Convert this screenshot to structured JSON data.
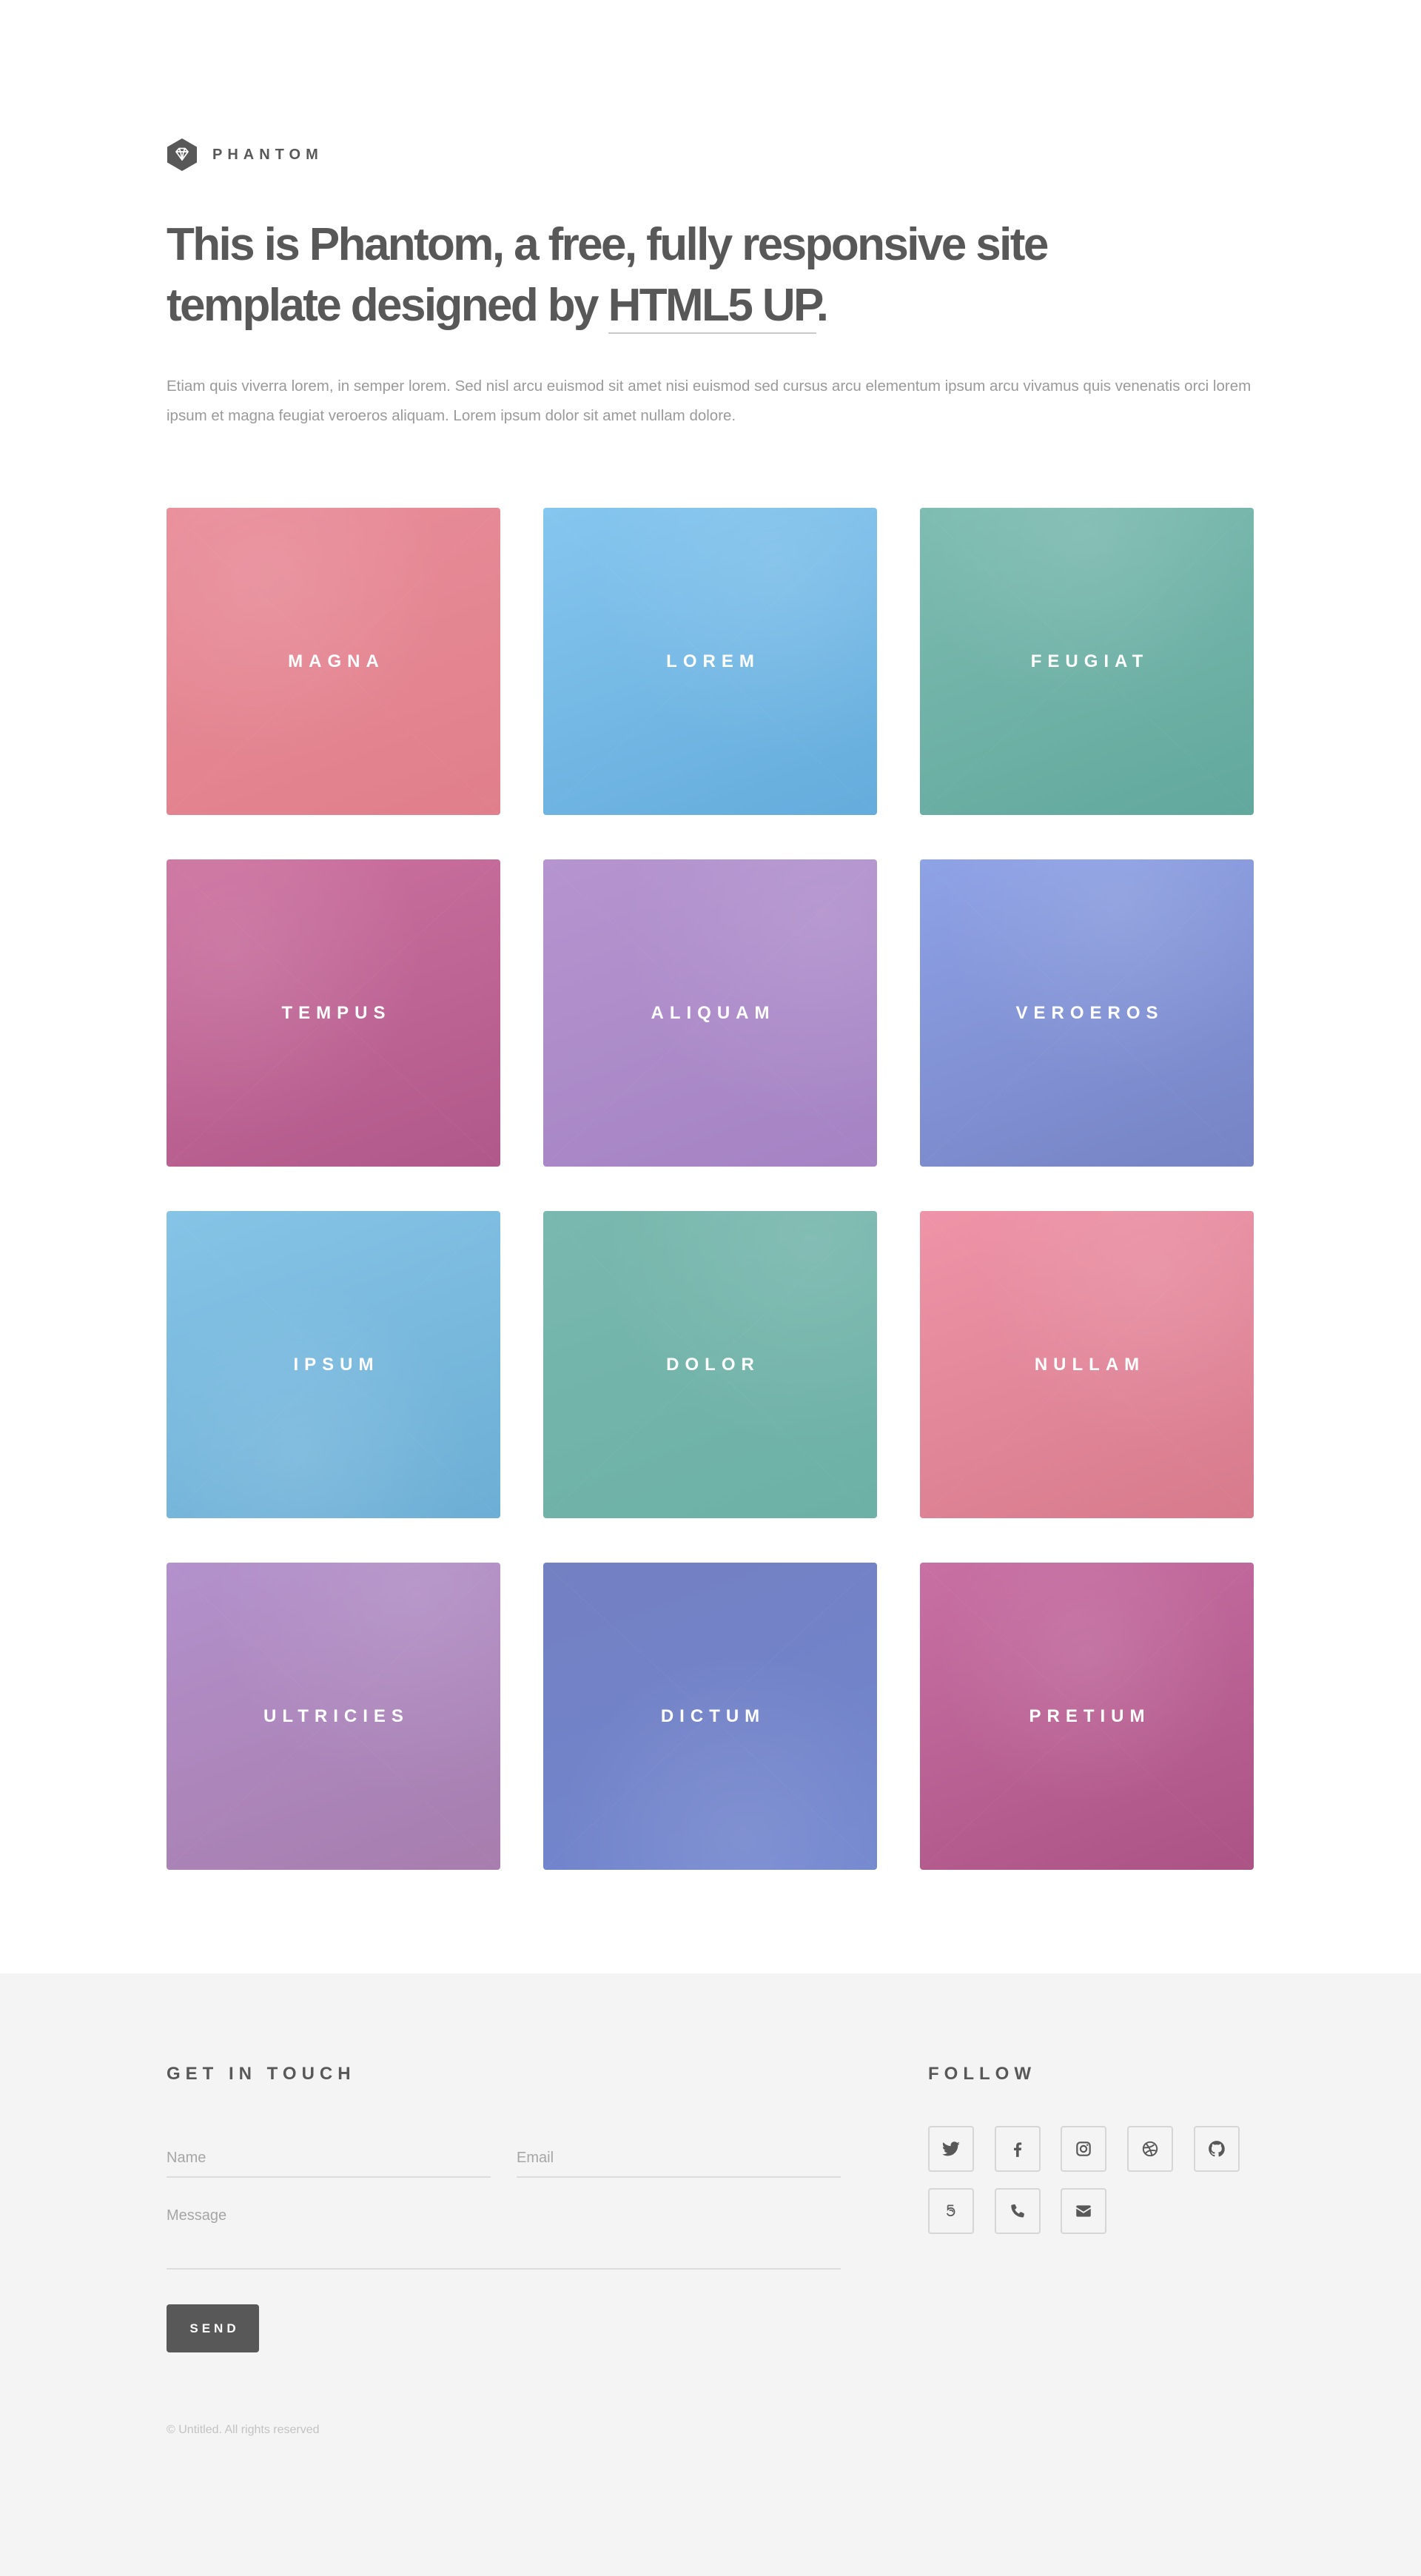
{
  "brand": {
    "name": "PHANTOM",
    "logo_icon": "diamond-hexagon-icon"
  },
  "header": {
    "headline_prefix": "This is Phantom, a free, fully responsive site template designed by ",
    "headline_link": "HTML5 UP",
    "headline_suffix": ".",
    "intro": "Etiam quis viverra lorem, in semper lorem. Sed nisl arcu euismod sit amet nisi euismod sed cursus arcu elementum ipsum arcu vivamus quis venenatis orci lorem ipsum et magna feugiat veroeros aliquam. Lorem ipsum dolor sit amet nullam dolore."
  },
  "tiles": [
    {
      "label": "MAGNA",
      "color_a": "#e98d9a",
      "color_b": "#e07f8b"
    },
    {
      "label": "LOREM",
      "color_a": "#85c6ef",
      "color_b": "#65acdc"
    },
    {
      "label": "FEUGIAT",
      "color_a": "#7ebcb1",
      "color_b": "#62a89d"
    },
    {
      "label": "TEMPUS",
      "color_a": "#cd72a0",
      "color_b": "#b0588a"
    },
    {
      "label": "ALIQUAM",
      "color_a": "#b594cf",
      "color_b": "#a583c4"
    },
    {
      "label": "VEROEROS",
      "color_a": "#8ea2e6",
      "color_b": "#7683c4"
    },
    {
      "label": "IPSUM",
      "color_a": "#86c4e6",
      "color_b": "#6caed5"
    },
    {
      "label": "DOLOR",
      "color_a": "#79b8ae",
      "color_b": "#6cb0a6"
    },
    {
      "label": "NULLAM",
      "color_a": "#ef93a8",
      "color_b": "#d67a8c"
    },
    {
      "label": "ULTRICIES",
      "color_a": "#b391cc",
      "color_b": "#a77dad"
    },
    {
      "label": "DICTUM",
      "color_a": "#7380c2",
      "color_b": "#7286cf"
    },
    {
      "label": "PRETIUM",
      "color_a": "#c870a4",
      "color_b": "#ab5384"
    }
  ],
  "contact": {
    "title": "GET IN TOUCH",
    "name_placeholder": "Name",
    "email_placeholder": "Email",
    "message_placeholder": "Message",
    "send_label": "SEND"
  },
  "follow": {
    "title": "FOLLOW",
    "icons": [
      "twitter-icon",
      "facebook-icon",
      "instagram-icon",
      "dribbble-icon",
      "github-icon",
      "500px-icon",
      "phone-icon",
      "envelope-icon"
    ]
  },
  "footer": {
    "copyright": "© Untitled. All rights reserved"
  }
}
